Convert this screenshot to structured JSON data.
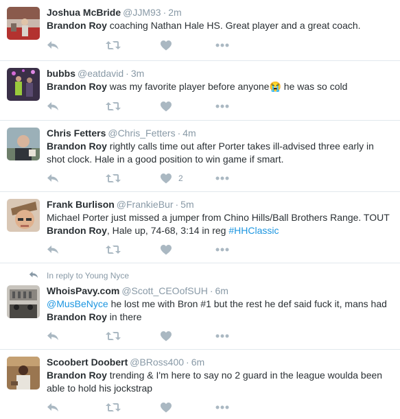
{
  "tweets": [
    {
      "name": "Joshua McBride",
      "handle": "@JJM93",
      "time": "2m",
      "segments": [
        {
          "t": "Brandon Roy",
          "s": "bold"
        },
        {
          "t": " coaching Nathan Hale HS. Great player and a great coach.",
          "s": "plain"
        }
      ],
      "likes": ""
    },
    {
      "name": "bubbs",
      "handle": "@eatdavid",
      "time": "3m",
      "segments": [
        {
          "t": "Brandon Roy",
          "s": "bold"
        },
        {
          "t": " was my favorite player before anyone",
          "s": "plain"
        },
        {
          "t": "😭",
          "s": "emoji"
        },
        {
          "t": " he was so cold",
          "s": "plain"
        }
      ],
      "likes": ""
    },
    {
      "name": "Chris Fetters",
      "handle": "@Chris_Fetters",
      "time": "4m",
      "segments": [
        {
          "t": "Brandon Roy",
          "s": "bold"
        },
        {
          "t": " rightly calls time out after Porter takes ill-advised three early in shot clock. Hale in a good position to win game if smart.",
          "s": "plain"
        }
      ],
      "likes": "2"
    },
    {
      "name": "Frank Burlison",
      "handle": "@FrankieBur",
      "time": "5m",
      "segments": [
        {
          "t": "Michael Porter just missed a jumper from Chino Hills/Ball Brothers Range. TOUT ",
          "s": "plain"
        },
        {
          "t": "Brandon Roy",
          "s": "bold"
        },
        {
          "t": ", Hale up, 74-68, 3:14 in reg ",
          "s": "plain"
        },
        {
          "t": "#HHClassic",
          "s": "link"
        }
      ],
      "likes": ""
    },
    {
      "context": "In reply to Young Nyce",
      "name": "WhoisPavy.com",
      "handle": "@Scott_CEOofSUH",
      "time": "6m",
      "segments": [
        {
          "t": "@MusBeNyce",
          "s": "link"
        },
        {
          "t": " he lost me with Bron #1 but the rest he def said fuck it, mans had ",
          "s": "plain"
        },
        {
          "t": "Brandon Roy",
          "s": "bold"
        },
        {
          "t": " in there",
          "s": "plain"
        }
      ],
      "likes": ""
    },
    {
      "name": "Scoobert Doobert",
      "handle": "@BRoss400",
      "time": "6m",
      "segments": [
        {
          "t": "Brandon Roy",
          "s": "bold"
        },
        {
          "t": " trending & I'm here to say no 2 guard in the league woulda been able to hold his jockstrap",
          "s": "plain"
        }
      ],
      "likes": ""
    }
  ],
  "icons": {
    "reply": "reply-icon",
    "retweet": "retweet-icon",
    "like": "heart-icon",
    "more": "more-dots-icon",
    "context": "reply-arrow-icon"
  },
  "colors": {
    "icon": "#aab8c2",
    "link": "#1b95e0",
    "muted": "#8899a6",
    "divider": "#e1e8ed"
  }
}
